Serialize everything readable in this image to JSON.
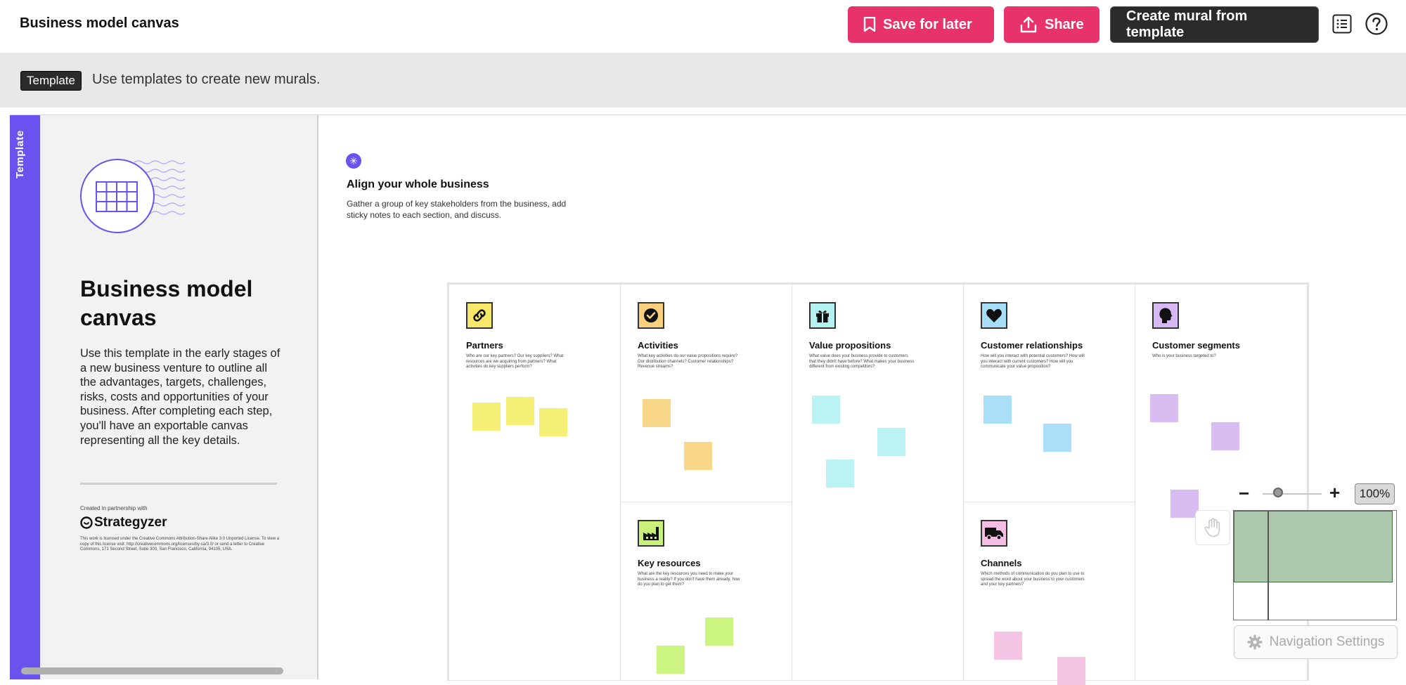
{
  "header": {
    "title": "Business model canvas",
    "save_label": "Save for later",
    "share_label": "Share",
    "create_label": "Create mural from template"
  },
  "banner": {
    "tag": "Template",
    "text": "Use templates to create new murals."
  },
  "panel": {
    "stripe_label": "Template",
    "title": "Business model canvas",
    "description": "Use this template in the early stages of a new business venture to outline all the advantages, targets, challenges, risks, costs and opportunities of your business. After completing each step, you'll have an exportable canvas representing all the key details.",
    "partner_label": "Created in partnership with",
    "partner_name": "Strategyzer",
    "license": "This work is licensed under the Creative Commons Attribution-Share Alike 3.0 Unported License. To view a copy of this license visit: http://creativecommons.org/licenses/by-sa/3.0/ or send a letter to Creative Commons, 171 Second Street, Suite 300, San Francisco, California, 94105, USA."
  },
  "intro": {
    "title": "Align your whole business",
    "description": "Gather a group of key stakeholders from the business, add sticky notes to each section, and discuss."
  },
  "sections": {
    "partners": {
      "title": "Partners",
      "desc": "Who are our key partners? Our key suppliers? What resources are we acquiring from partners? What activities do key suppliers perform?",
      "color": "#f6e86a",
      "icon": "link-icon"
    },
    "activities": {
      "title": "Activities",
      "desc": "What key activities do our value propositions require? Our distribution channels? Customer relationships? Revenue streams?",
      "color": "#f8cf7c",
      "icon": "check-circle-icon"
    },
    "resources": {
      "title": "Key resources",
      "desc": "What are the key resources you need to make your business a reality? If you don't have them already, how do you plan to get them?",
      "color": "#c8f27a",
      "icon": "factory-icon"
    },
    "value": {
      "title": "Value propositions",
      "desc": "What value does your business provide to customers that they didn't have before? What makes your business different from existing competitors?",
      "color": "#b4f2f0",
      "icon": "gift-icon"
    },
    "relationships": {
      "title": "Customer relationships",
      "desc": "How will you interact with potential customers? How will you interact with current customers? How will you communicate your value proposition?",
      "color": "#a6def8",
      "icon": "heart-icon"
    },
    "channels": {
      "title": "Channels",
      "desc": "Which methods of communication do you plan to use to spread the word about your business to your customers and your key partners?",
      "color": "#f4bde2",
      "icon": "truck-icon"
    },
    "segments": {
      "title": "Customer segments",
      "desc": "Who is your business targeted to?",
      "color": "#d6b8f2",
      "icon": "head-icon"
    }
  },
  "zoom": {
    "level": "100%",
    "minus": "−",
    "plus": "+"
  },
  "nav_settings_label": "Navigation Settings",
  "colors": {
    "accent_pink": "#e8336a",
    "dark": "#2b2b2b",
    "template_purple": "#6a52ef"
  }
}
